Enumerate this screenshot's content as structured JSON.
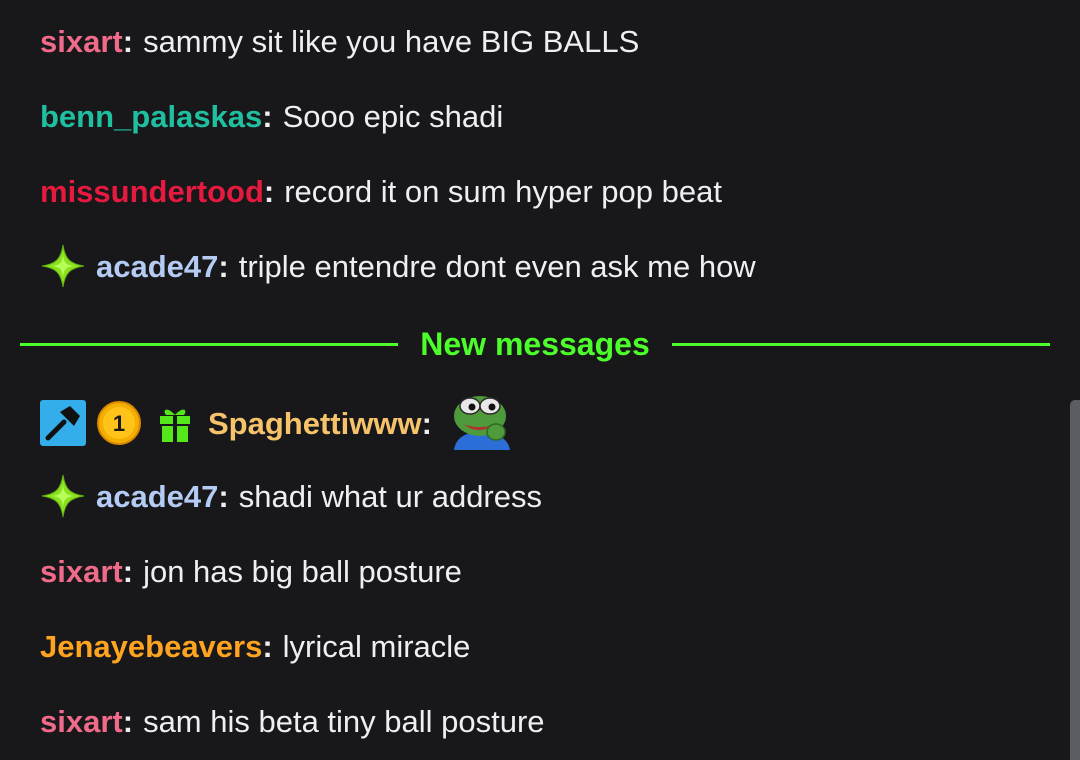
{
  "messages_before": [
    {
      "user": "sixart",
      "color": "#f06a8a",
      "text": "sammy sit like you have BIG BALLS",
      "badges": []
    },
    {
      "user": "benn_palaskas",
      "color": "#1fbfa0",
      "text": "Sooo epic shadi",
      "badges": []
    },
    {
      "user": "missundertood",
      "color": "#e6193f",
      "text": "record it on sum hyper pop beat",
      "badges": []
    },
    {
      "user": "acade47",
      "color": "#b4ccf3",
      "text": "triple entendre dont even ask me how",
      "badges": [
        "sparkle-badge-icon"
      ]
    }
  ],
  "divider": {
    "label": "New messages",
    "color": "#4cff2b"
  },
  "messages_after": [
    {
      "user": "Spaghettiwww",
      "color": "#f6c26a",
      "text": "",
      "badges": [
        "moderator-badge-icon",
        "sub-tier-1-badge-icon",
        "gift-badge-icon"
      ],
      "emote": "pepe-emote-icon"
    },
    {
      "user": "acade47",
      "color": "#b4ccf3",
      "text": "shadi what ur address",
      "badges": [
        "sparkle-badge-icon"
      ]
    },
    {
      "user": "sixart",
      "color": "#f06a8a",
      "text": "jon has big ball posture",
      "badges": []
    },
    {
      "user": "Jenayebeavers",
      "color": "#ffa41f",
      "text": "lyrical miracle",
      "badges": []
    },
    {
      "user": "sixart",
      "color": "#f06a8a",
      "text": "sam his beta tiny ball posture",
      "badges": []
    }
  ],
  "badge_text": {
    "sub_tier": "1"
  }
}
